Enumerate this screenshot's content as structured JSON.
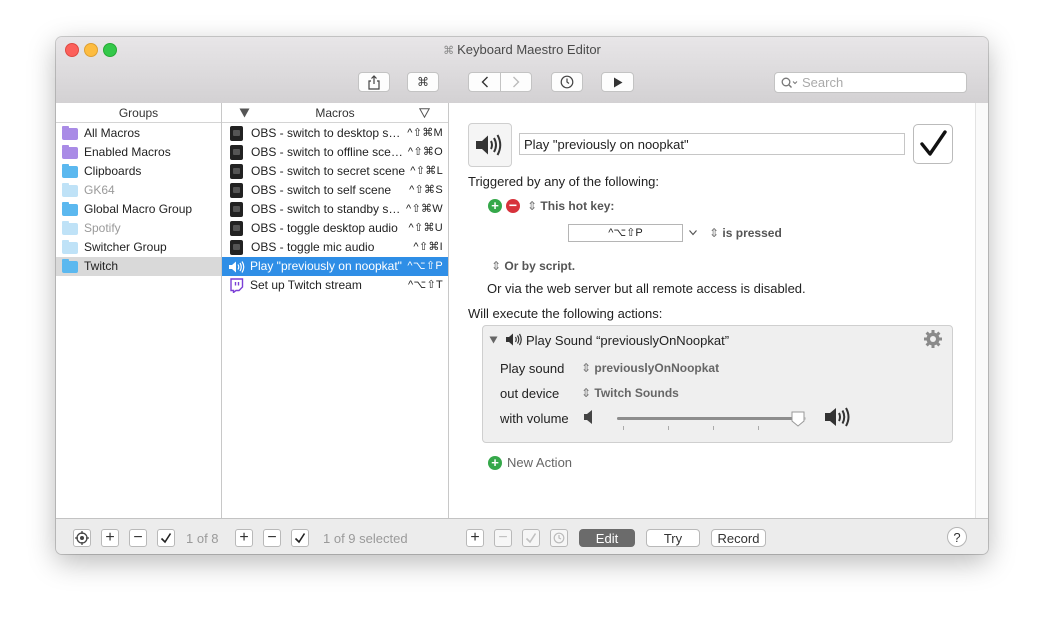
{
  "window": {
    "title": "Keyboard Maestro Editor",
    "title_icon": "⌘"
  },
  "toolbar": {
    "share_icon": "share-icon",
    "cmd_label": "⌘",
    "back_icon": "chevron-left-icon",
    "forward_icon": "chevron-right-icon",
    "history_icon": "clock-icon",
    "run_icon": "play-icon",
    "search_placeholder": "Search"
  },
  "groups": {
    "header": "Groups",
    "items": [
      {
        "label": "All Macros",
        "color": "purple",
        "dim": false
      },
      {
        "label": "Enabled Macros",
        "color": "purple",
        "dim": false
      },
      {
        "label": "Clipboards",
        "color": "blue",
        "dim": false
      },
      {
        "label": "GK64",
        "color": "light",
        "dim": true
      },
      {
        "label": "Global Macro Group",
        "color": "blue",
        "dim": false
      },
      {
        "label": "Spotify",
        "color": "light",
        "dim": true
      },
      {
        "label": "Switcher Group",
        "color": "light",
        "dim": false
      },
      {
        "label": "Twitch",
        "color": "blue",
        "dim": false,
        "selected": true
      }
    ]
  },
  "macros": {
    "header": "Macros",
    "items": [
      {
        "name": "OBS - switch to desktop sc...",
        "key": "^⇧⌘M",
        "icon": "obs"
      },
      {
        "name": "OBS - switch to offline scene",
        "key": "^⇧⌘O",
        "icon": "obs"
      },
      {
        "name": "OBS - switch to secret scene",
        "key": "^⇧⌘L",
        "icon": "obs"
      },
      {
        "name": "OBS - switch to self scene",
        "key": "^⇧⌘S",
        "icon": "obs"
      },
      {
        "name": "OBS - switch to standby sc...",
        "key": "^⇧⌘W",
        "icon": "obs"
      },
      {
        "name": "OBS - toggle desktop audio",
        "key": "^⇧⌘U",
        "icon": "obs"
      },
      {
        "name": "OBS - toggle mic audio",
        "key": "^⇧⌘I",
        "icon": "obs"
      },
      {
        "name": "Play \"previously on noopkat\"",
        "key": "^⌥⇧P",
        "icon": "speaker",
        "selected": true
      },
      {
        "name": "Set up Twitch stream",
        "key": "^⌥⇧T",
        "icon": "twitch"
      }
    ]
  },
  "editor": {
    "macro_name": "Play \"previously on noopkat\"",
    "triggered_label": "Triggered by any of the following:",
    "hotkey_label": "This hot key:",
    "hotkey_value": "^⌥⇧P",
    "is_pressed": "is pressed",
    "or_by_script": "Or by script.",
    "web_server_text": "Or via the web server but all remote access is disabled.",
    "actions_label": "Will execute the following actions:",
    "action": {
      "title": "Play Sound “previouslyOnNoopkat”",
      "play_sound_label": "Play sound",
      "play_sound_value": "previouslyOnNoopkat",
      "out_device_label": "out device",
      "out_device_value": "Twitch Sounds",
      "volume_label": "with volume",
      "volume_fraction": 0.96
    },
    "new_action": "New Action"
  },
  "bottom": {
    "groups_count": "1 of 8",
    "macros_count": "1 of 9 selected",
    "edit_label": "Edit",
    "try_label": "Try",
    "record_label": "Record",
    "help_label": "?"
  },
  "colors": {
    "selection_blue": "#2f8ee6",
    "folder_blue": "#5bb8ef",
    "folder_purple": "#a98be6",
    "enable_check": "#111111"
  }
}
